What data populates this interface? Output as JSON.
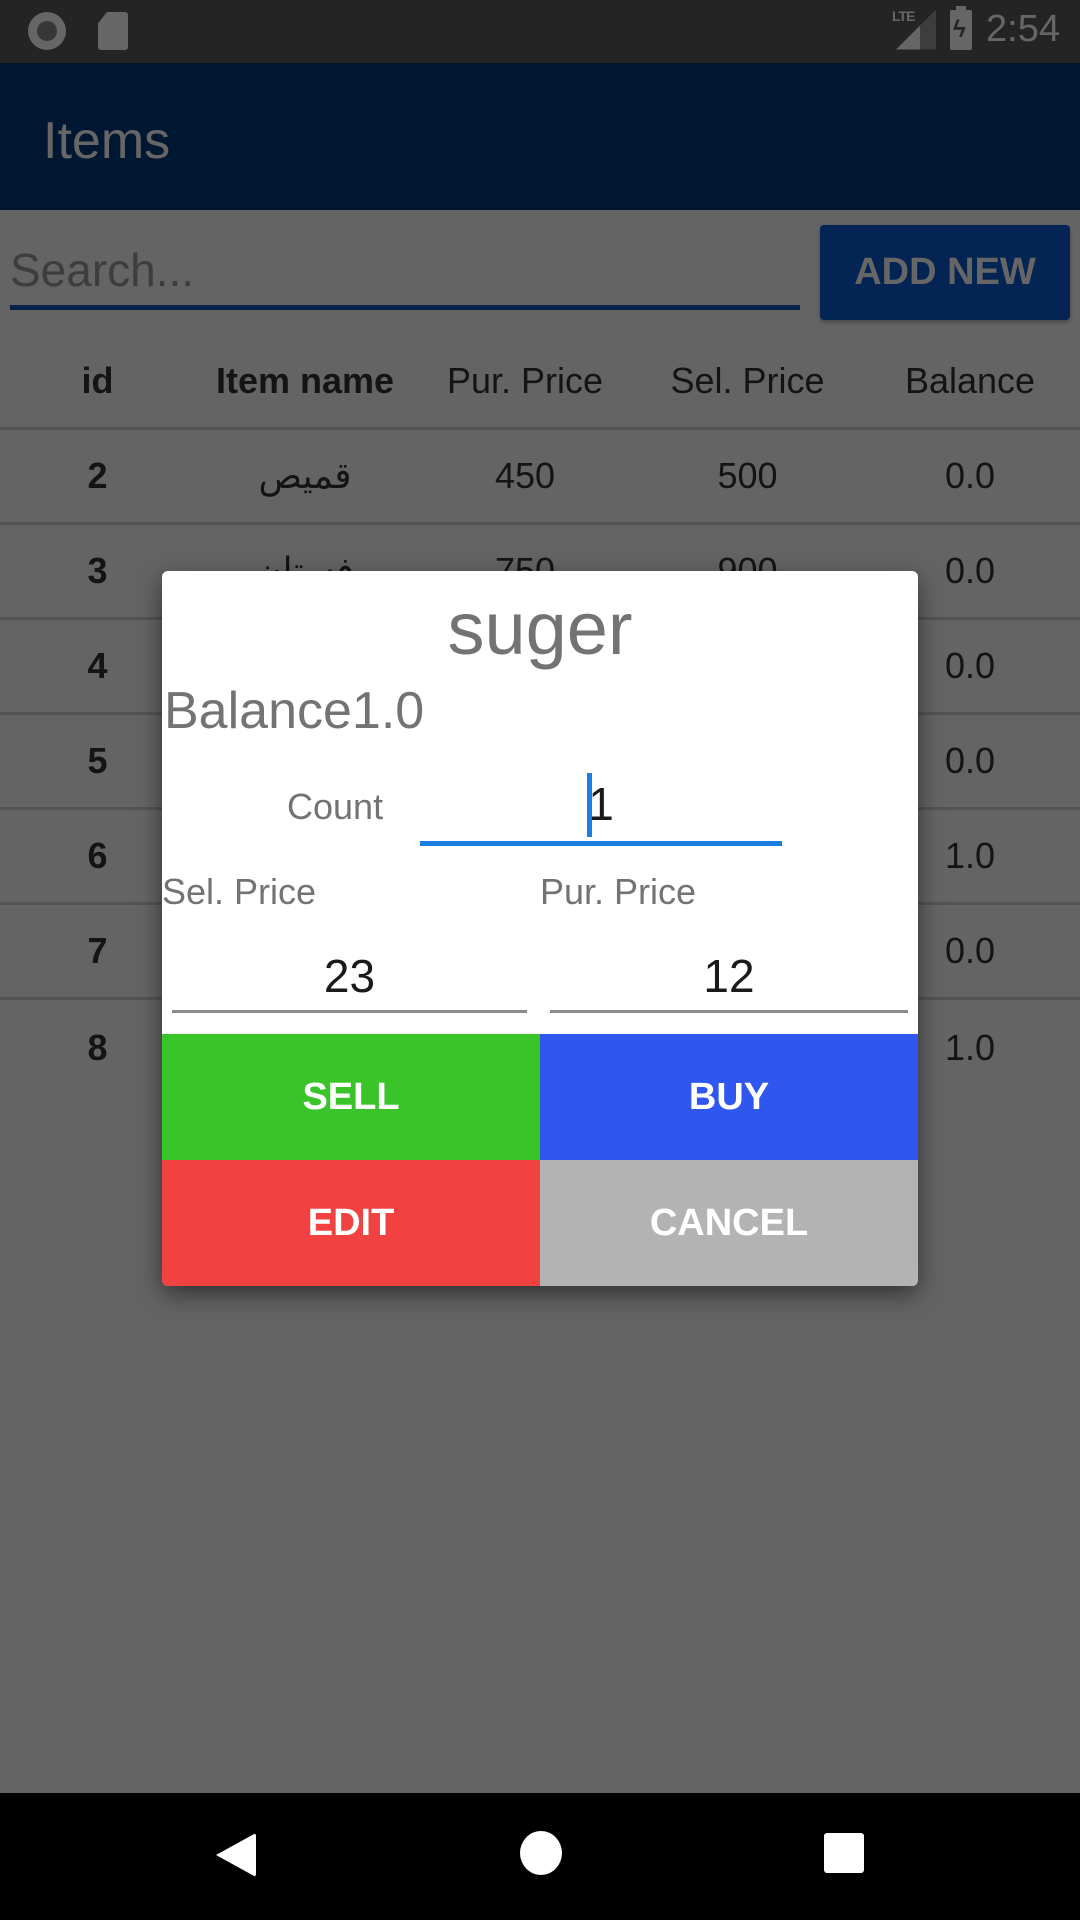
{
  "status_bar": {
    "time": "2:54",
    "network": "LTE",
    "icons": [
      "screen-record-icon",
      "sd-card-icon",
      "lte-signal-icon",
      "battery-charging-icon"
    ]
  },
  "app_bar": {
    "title": "Items"
  },
  "search": {
    "placeholder": "Search...",
    "value": ""
  },
  "add_new_label": "ADD NEW",
  "table": {
    "headers": [
      "id",
      "Item name",
      "Pur. Price",
      "Sel. Price",
      "Balance"
    ],
    "rows": [
      {
        "id": "2",
        "name": "قميص",
        "pur": "450",
        "sel": "500",
        "balance": "0.0"
      },
      {
        "id": "3",
        "name": "فستان",
        "pur": "750",
        "sel": "900",
        "balance": "0.0"
      },
      {
        "id": "4",
        "name": "",
        "pur": "",
        "sel": "",
        "balance": "0.0"
      },
      {
        "id": "5",
        "name": "",
        "pur": "",
        "sel": "",
        "balance": "0.0"
      },
      {
        "id": "6",
        "name": "",
        "pur": "",
        "sel": "",
        "balance": "1.0"
      },
      {
        "id": "7",
        "name": "",
        "pur": "",
        "sel": "",
        "balance": "0.0"
      },
      {
        "id": "8",
        "name": "",
        "pur": "",
        "sel": "",
        "balance": "1.0"
      }
    ]
  },
  "dialog": {
    "title": "suger",
    "balance_text": "Balance1.0",
    "count_label": "Count",
    "count_value": "1",
    "sel_price_label": "Sel. Price",
    "pur_price_label": "Pur. Price",
    "sel_price_value": "23",
    "pur_price_value": "12",
    "buttons": {
      "sell": "SELL",
      "buy": "BUY",
      "edit": "EDIT",
      "cancel": "CANCEL"
    }
  },
  "colors": {
    "app_bar": "#003b7a",
    "accent": "#1a7fe0",
    "sell": "#39c42a",
    "buy": "#2f57f0",
    "edit": "#f24141",
    "cancel": "#b3b3b3"
  },
  "nav_bar": {
    "icons": [
      "back-icon",
      "home-icon",
      "recents-icon"
    ]
  }
}
